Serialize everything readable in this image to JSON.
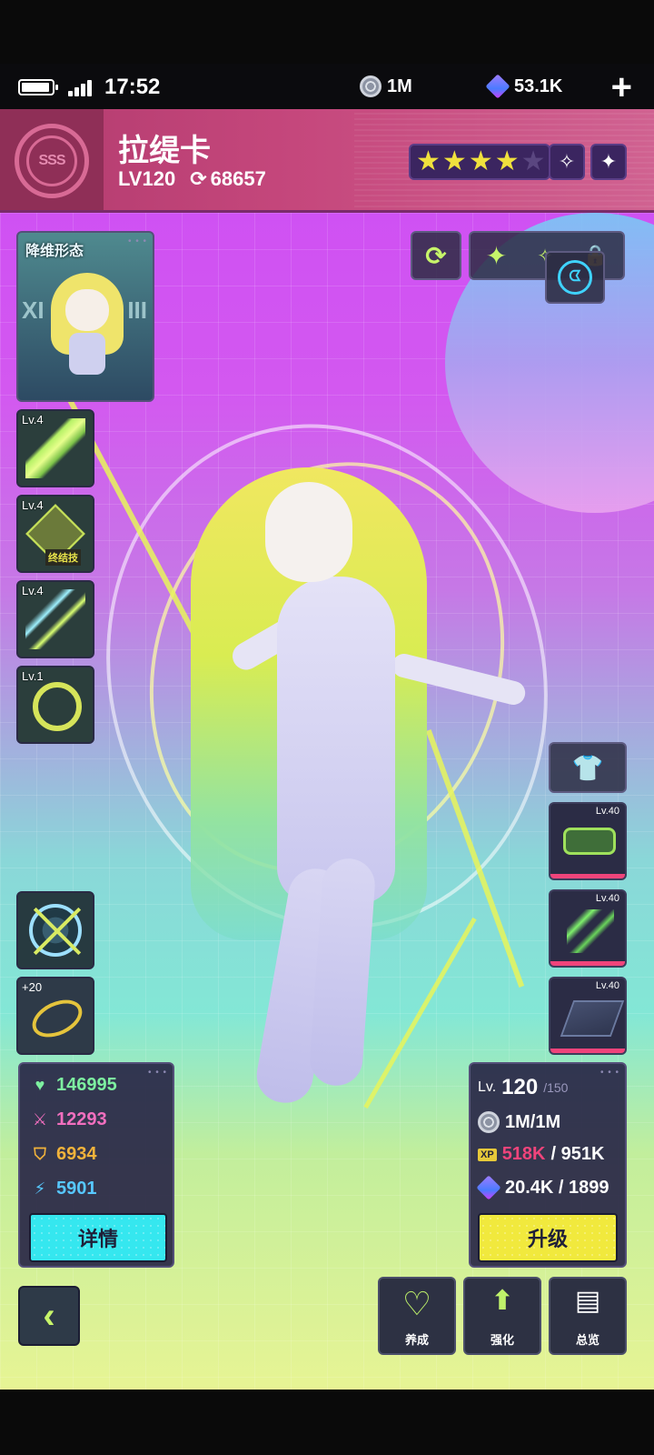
{
  "status": {
    "time": "17:52",
    "battery_level": 0.85,
    "currency1": "1M",
    "currency2": "53.1K",
    "plus": "+"
  },
  "header": {
    "rank_badge": "SSS",
    "name": "拉缇卡",
    "level": "LV120",
    "power": "68657",
    "stars_filled": 4,
    "stars_total": 5
  },
  "portrait": {
    "title": "降维形态",
    "roman_left": "XI",
    "roman_right": "III"
  },
  "skills": [
    {
      "level": "Lv.4",
      "tag": ""
    },
    {
      "level": "Lv.4",
      "tag": "终结技"
    },
    {
      "level": "Lv.4",
      "tag": ""
    },
    {
      "level": "Lv.1",
      "tag": ""
    }
  ],
  "emblems": [
    {
      "label": ""
    },
    {
      "label": "+20"
    }
  ],
  "gear": [
    {
      "level": "Lv.40"
    },
    {
      "level": "Lv.40"
    },
    {
      "level": "Lv.40"
    }
  ],
  "stats": {
    "hp": "146995",
    "atk": "12293",
    "def": "6934",
    "spd": "5901",
    "detail_label": "详情"
  },
  "level_panel": {
    "lv_label": "Lv.",
    "lv": "120",
    "lv_max": "/150",
    "coins": "1M/1M",
    "xp_have": "518K",
    "xp_need": "/ 951K",
    "cubes": "20.4K / 1899",
    "upgrade_label": "升级"
  },
  "nav": {
    "nurture": "养成",
    "enhance": "强化",
    "overview": "总览",
    "back": "‹"
  },
  "colors": {
    "accent_green": "#c7f46a",
    "hp": "#7df0a0",
    "atk": "#f26fbf",
    "def": "#f2b33b",
    "spd": "#57c8ff",
    "xp": "#f0447b",
    "detail_button": "#35e7ef",
    "upgrade_button": "#f1e93d"
  }
}
